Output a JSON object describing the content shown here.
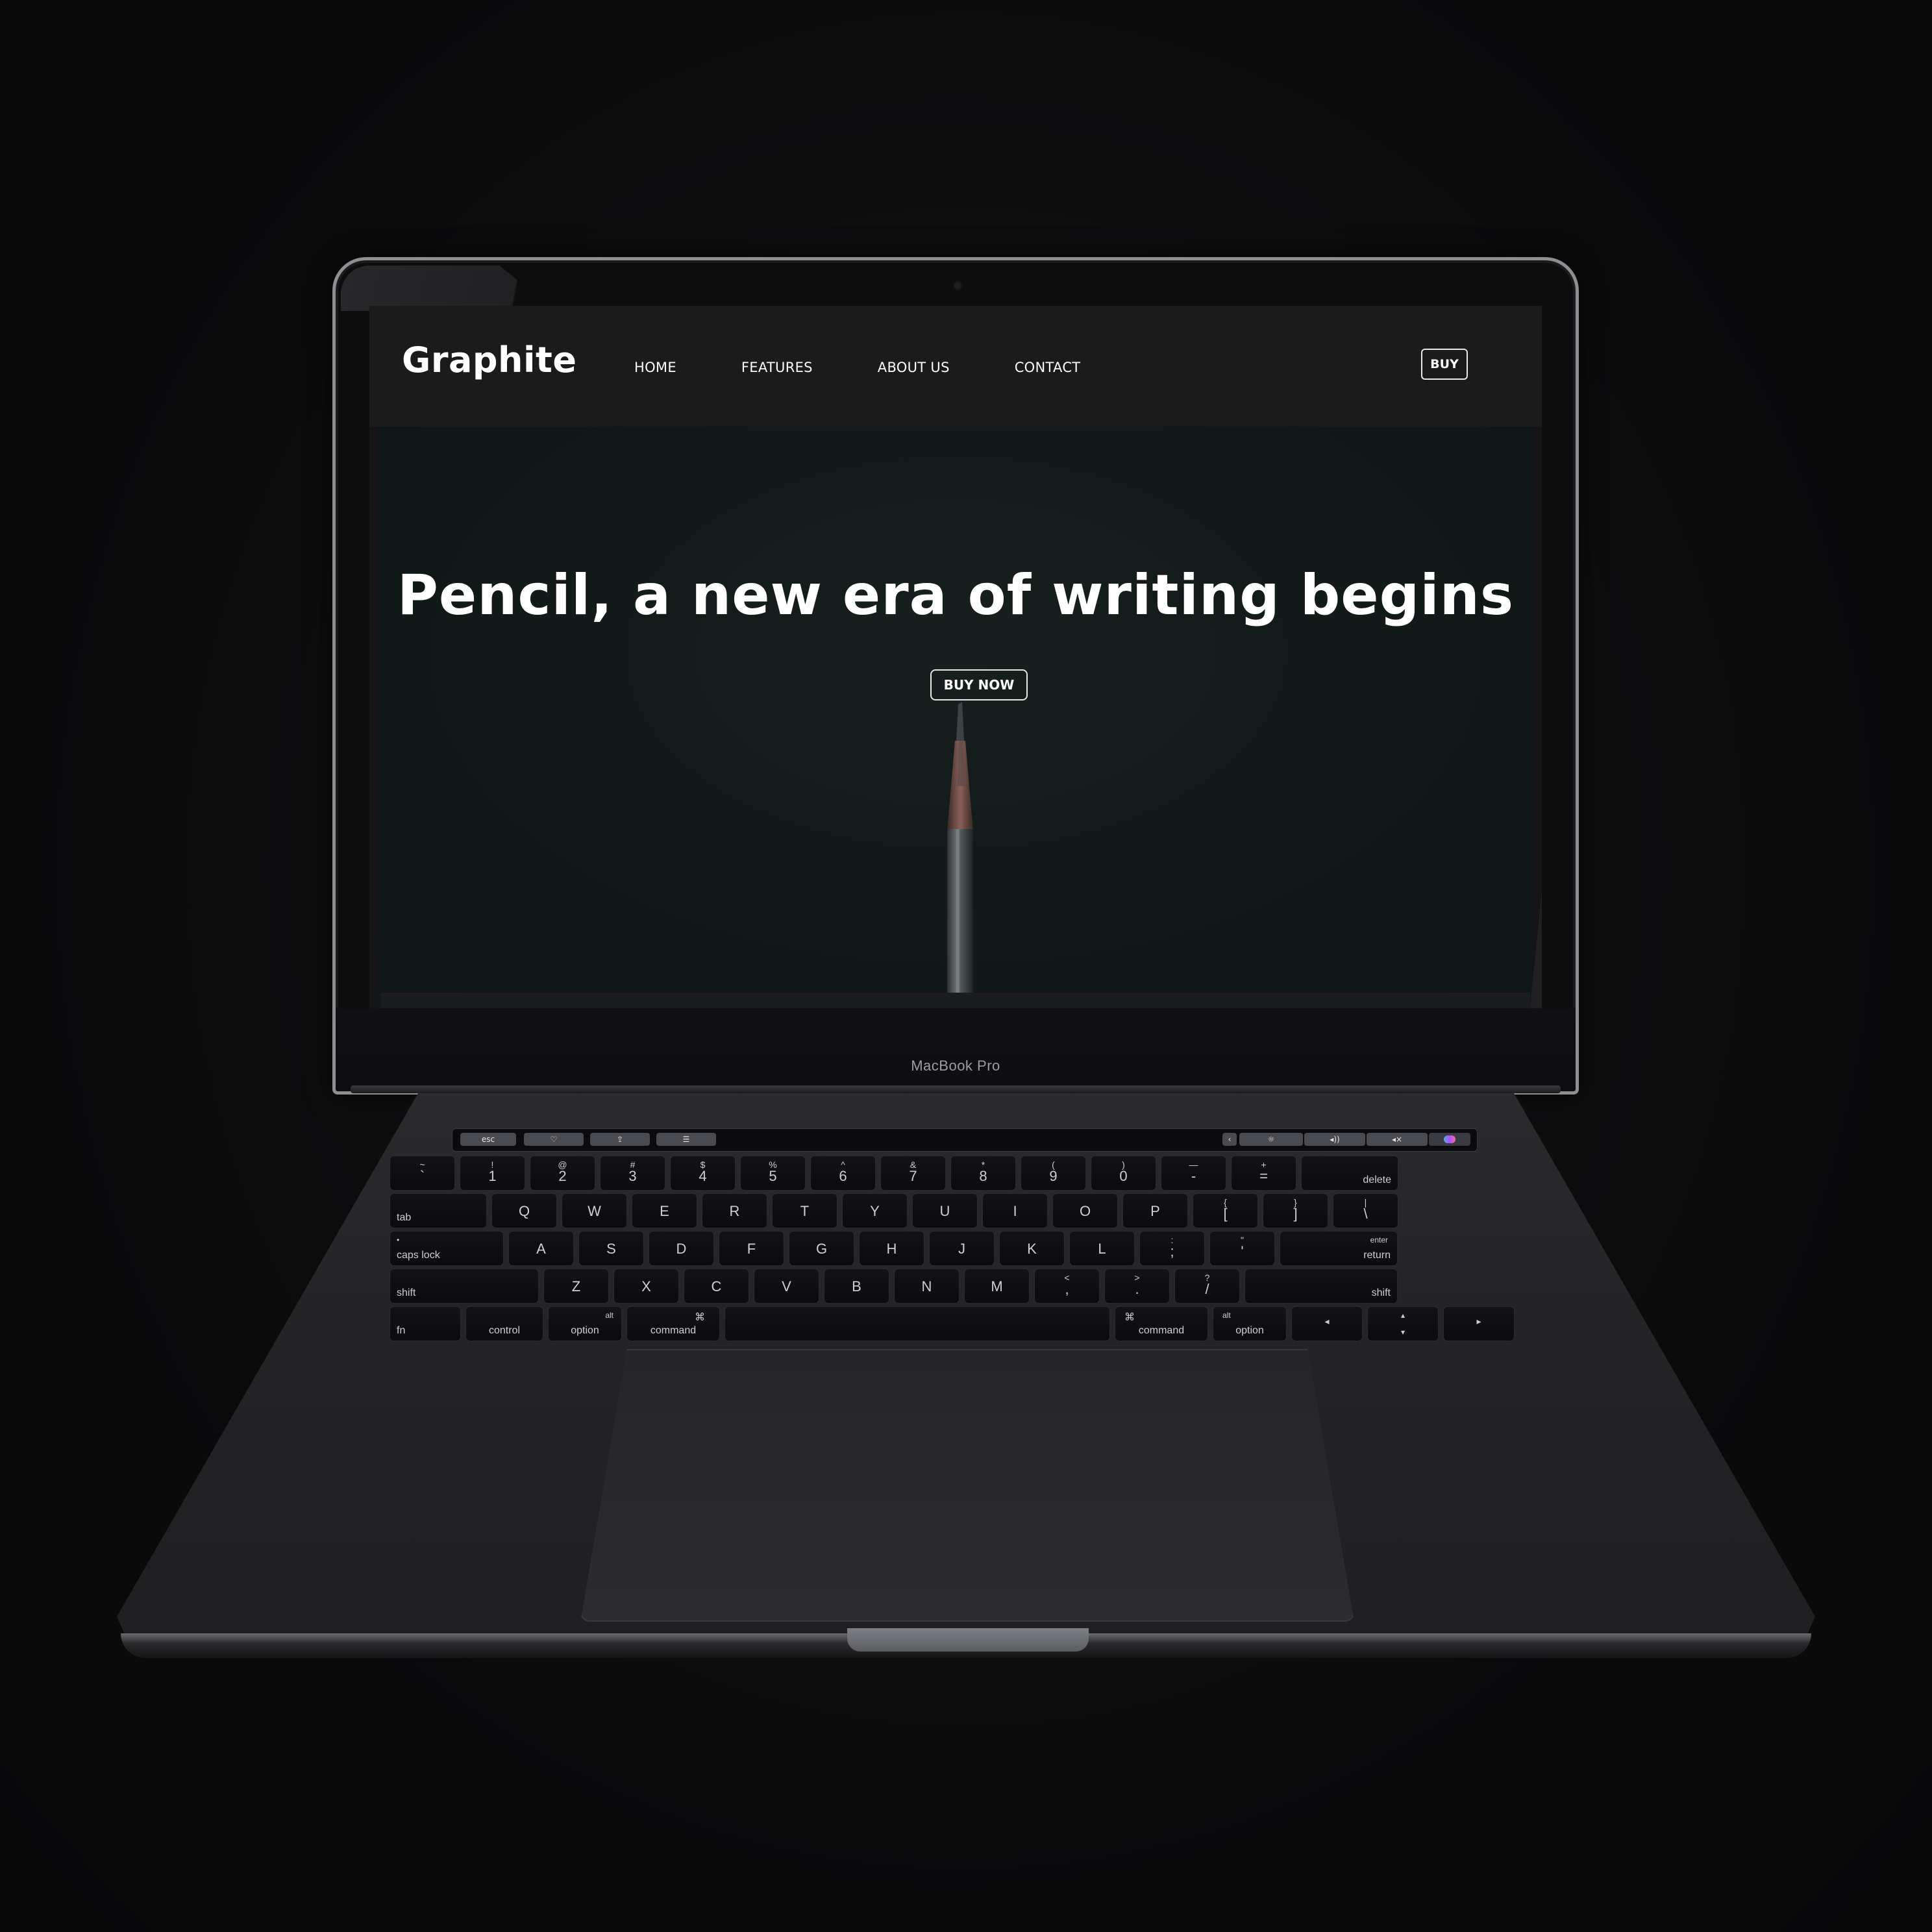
{
  "device": {
    "label": "MacBook Pro"
  },
  "site": {
    "logo": "Graphite",
    "nav": [
      {
        "label": "HOME"
      },
      {
        "label": "FEATURES"
      },
      {
        "label": "ABOUT US"
      },
      {
        "label": "CONTACT"
      }
    ],
    "buy_label": "BUY",
    "hero": {
      "title": "Pencil, a new era of writing begins",
      "cta_label": "BUY NOW"
    }
  },
  "keyboard": {
    "touchbar": {
      "esc": "esc"
    },
    "number_row": [
      {
        "top": "~",
        "main": "`"
      },
      {
        "top": "!",
        "main": "1"
      },
      {
        "top": "@",
        "main": "2"
      },
      {
        "top": "#",
        "main": "3"
      },
      {
        "top": "$",
        "main": "4"
      },
      {
        "top": "%",
        "main": "5"
      },
      {
        "top": "^",
        "main": "6"
      },
      {
        "top": "&",
        "main": "7"
      },
      {
        "top": "*",
        "main": "8"
      },
      {
        "top": "(",
        "main": "9"
      },
      {
        "top": ")",
        "main": "0"
      },
      {
        "top": "—",
        "main": "-"
      },
      {
        "top": "+",
        "main": "="
      }
    ],
    "delete": "delete",
    "tab": "tab",
    "qwerty": [
      "Q",
      "W",
      "E",
      "R",
      "T",
      "Y",
      "U",
      "I",
      "O",
      "P"
    ],
    "brackets": [
      {
        "top": "{",
        "main": "["
      },
      {
        "top": "}",
        "main": "]"
      },
      {
        "top": "|",
        "main": "\\"
      }
    ],
    "caps_lock": "caps lock",
    "home_row": [
      "A",
      "S",
      "D",
      "F",
      "G",
      "H",
      "J",
      "K",
      "L"
    ],
    "home_punct": [
      {
        "top": ":",
        "main": ";"
      },
      {
        "top": "\"",
        "main": "'"
      }
    ],
    "enter_top": "enter",
    "enter": "return",
    "shift": "shift",
    "bottom_letters": [
      "Z",
      "X",
      "C",
      "V",
      "B",
      "N",
      "M"
    ],
    "bottom_punct": [
      {
        "top": "<",
        "main": ","
      },
      {
        "top": ">",
        "main": "."
      },
      {
        "top": "?",
        "main": "/"
      }
    ],
    "fn": "fn",
    "control": "control",
    "option": "option",
    "alt": "alt",
    "command": "command",
    "command_symbol": "⌘"
  }
}
